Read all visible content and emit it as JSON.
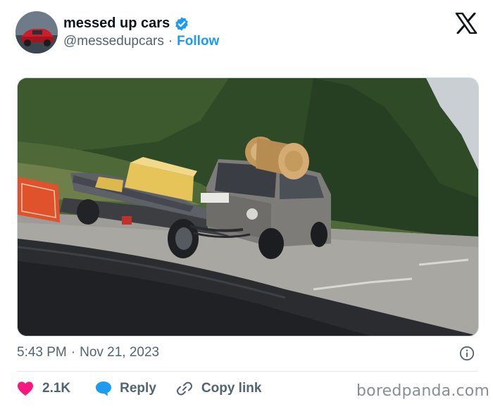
{
  "author": {
    "display_name": "messed up cars",
    "handle": "@messedupcars",
    "separator": "·",
    "follow_label": "Follow",
    "verified": true
  },
  "post": {
    "time": "5:43 PM",
    "separator": "·",
    "date": "Nov 21, 2023"
  },
  "actions": {
    "like_count": "2.1K",
    "reply_label": "Reply",
    "copy_link_label": "Copy link"
  },
  "colors": {
    "accent": "#1d9bf0",
    "like": "#f91880",
    "muted_text": "#536471"
  },
  "icons": {
    "platform": "x-logo-icon",
    "verified": "verified-badge-icon",
    "info": "info-icon",
    "like": "heart-icon",
    "reply": "speech-bubble-icon",
    "copy": "link-icon"
  },
  "watermark": "boredpanda.com"
}
